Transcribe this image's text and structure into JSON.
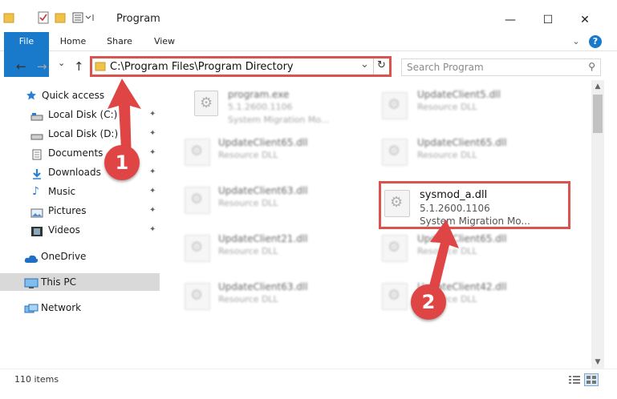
{
  "window": {
    "title": "Program",
    "minimize_glyph": "—",
    "maximize_glyph": "☐",
    "close_glyph": "✕"
  },
  "ribbon": {
    "tabs": [
      {
        "label": "File"
      },
      {
        "label": "Home"
      },
      {
        "label": "Share"
      },
      {
        "label": "View"
      }
    ],
    "help_glyph": "?",
    "expand_glyph": "⌄"
  },
  "address_bar": {
    "path": "C:\\Program Files\\Program Directory",
    "dropdown_glyph": "⌄",
    "refresh_glyph": "↻"
  },
  "nav": {
    "back_glyph": "←",
    "forward_glyph": "→",
    "recent_glyph": "⌄",
    "up_glyph": "↑"
  },
  "search": {
    "placeholder": "Search Program",
    "icon_glyph": "⚲"
  },
  "sidebar": {
    "items": [
      {
        "label": "Quick access",
        "icon": "star-icon"
      },
      {
        "label": "Local Disk (C:)",
        "icon": "drive-icon",
        "pinned": true
      },
      {
        "label": "Local Disk (D:)",
        "icon": "drive-icon",
        "pinned": true
      },
      {
        "label": "Documents",
        "icon": "documents-icon",
        "pinned": true
      },
      {
        "label": "Downloads",
        "icon": "downloads-icon",
        "pinned": true
      },
      {
        "label": "Music",
        "icon": "music-icon",
        "pinned": true
      },
      {
        "label": "Pictures",
        "icon": "pictures-icon",
        "pinned": true
      },
      {
        "label": "Videos",
        "icon": "videos-icon",
        "pinned": true
      },
      {
        "label": "OneDrive",
        "icon": "cloud-icon"
      },
      {
        "label": "This PC",
        "icon": "computer-icon",
        "selected": true
      },
      {
        "label": "Network",
        "icon": "network-icon"
      }
    ],
    "pin_glyph": "📌"
  },
  "files": [
    {
      "name": "program.exe",
      "version": "5.1.2600.1106",
      "description": "System Migration Mo..."
    },
    {
      "name": "UpdateClient5.dll",
      "version": "Resource DLL",
      "description": ""
    },
    {
      "name": "UpdateClient65.dll",
      "version": "Resource DLL",
      "description": ""
    },
    {
      "name": "UpdateClient65.dll",
      "version": "Resource DLL",
      "description": ""
    },
    {
      "name": "UpdateClient63.dll",
      "version": "Resource DLL",
      "description": ""
    },
    {
      "name": "sysmod_a.dll",
      "version": "5.1.2600.1106",
      "description": "System Migration Mo..."
    },
    {
      "name": "UpdateClient21.dll",
      "version": "Resource DLL",
      "description": ""
    },
    {
      "name": "UpdateClient65.dll",
      "version": "Resource DLL",
      "description": ""
    },
    {
      "name": "UpdateClient63.dll",
      "version": "Resource DLL",
      "description": ""
    },
    {
      "name": "UpdateClient42.dll",
      "version": "Resource DLL",
      "description": ""
    }
  ],
  "status": {
    "item_count": "110 items"
  },
  "annotations": {
    "step1": "1",
    "step2": "2"
  },
  "colors": {
    "accent": "#1979ca",
    "highlight": "#d9534f",
    "annotation": "#e04545",
    "selected": "#d9d9d9"
  }
}
